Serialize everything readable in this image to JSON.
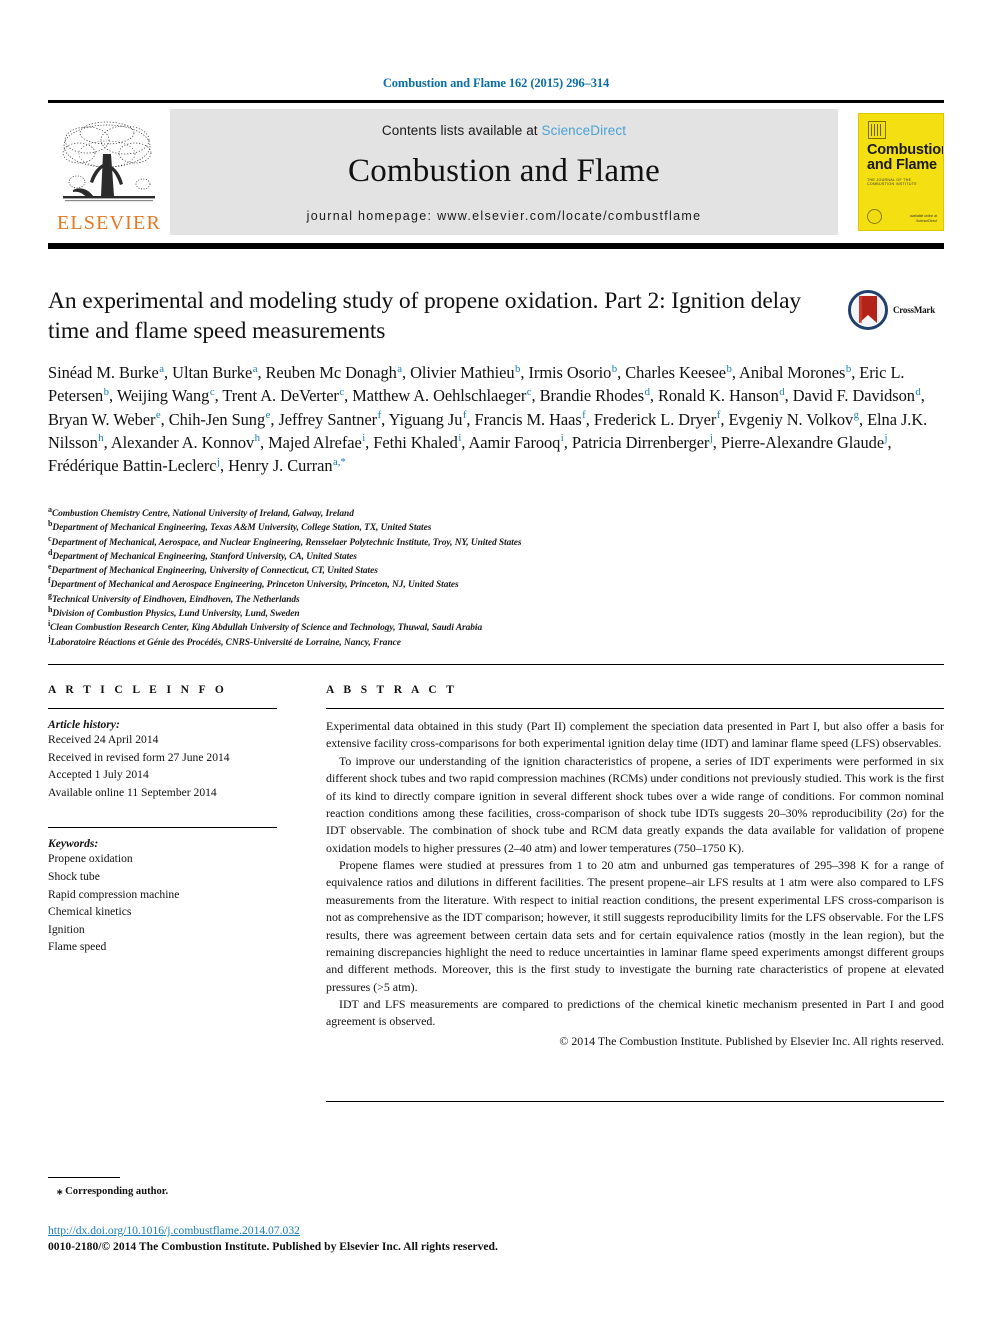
{
  "running_head": "Combustion and Flame 162 (2015) 296–314",
  "masthead": {
    "publisher_logo_label": "ELSEVIER",
    "contents_prefix": "Contents lists available at ",
    "contents_link": "ScienceDirect",
    "journal_name": "Combustion and Flame",
    "homepage": "journal homepage: www.elsevier.com/locate/combustflame",
    "cover": {
      "title_line1": "Combustion",
      "title_line2": "and Flame",
      "subtitle": "THE JOURNAL OF THE COMBUSTION INSTITUTE",
      "footline1": "available online at",
      "footline2": "ScienceDirect"
    }
  },
  "article": {
    "title": "An experimental and modeling study of propene oxidation. Part 2: Ignition delay time and flame speed measurements",
    "crossmark_label": "CrossMark"
  },
  "authors": [
    {
      "name": "Sinéad M. Burke",
      "sup": "a",
      "sep": ", "
    },
    {
      "name": "Ultan Burke",
      "sup": "a",
      "sep": ", "
    },
    {
      "name": "Reuben Mc Donagh",
      "sup": "a",
      "sep": ", "
    },
    {
      "name": "Olivier Mathieu",
      "sup": "b",
      "sep": ", "
    },
    {
      "name": "Irmis Osorio",
      "sup": "b",
      "sep": ", "
    },
    {
      "name": "Charles Keesee",
      "sup": "b",
      "sep": ", "
    },
    {
      "name": "Anibal Morones",
      "sup": "b",
      "sep": ", "
    },
    {
      "name": "Eric L. Petersen",
      "sup": "b",
      "sep": ", "
    },
    {
      "name": "Weijing Wang",
      "sup": "c",
      "sep": ", "
    },
    {
      "name": "Trent A. DeVerter",
      "sup": "c",
      "sep": ", "
    },
    {
      "name": "Matthew A. Oehlschlaeger",
      "sup": "c",
      "sep": ", "
    },
    {
      "name": "Brandie Rhodes",
      "sup": "d",
      "sep": ", "
    },
    {
      "name": "Ronald K. Hanson",
      "sup": "d",
      "sep": ", "
    },
    {
      "name": "David F. Davidson",
      "sup": "d",
      "sep": ", "
    },
    {
      "name": "Bryan W. Weber",
      "sup": "e",
      "sep": ", "
    },
    {
      "name": "Chih-Jen Sung",
      "sup": "e",
      "sep": ", "
    },
    {
      "name": "Jeffrey Santner",
      "sup": "f",
      "sep": ", "
    },
    {
      "name": "Yiguang Ju",
      "sup": "f",
      "sep": ", "
    },
    {
      "name": "Francis M. Haas",
      "sup": "f",
      "sep": ", "
    },
    {
      "name": "Frederick L. Dryer",
      "sup": "f",
      "sep": ", "
    },
    {
      "name": "Evgeniy N. Volkov",
      "sup": "g",
      "sep": ", "
    },
    {
      "name": "Elna J.K. Nilsson",
      "sup": "h",
      "sep": ", "
    },
    {
      "name": "Alexander A. Konnov",
      "sup": "h",
      "sep": ", "
    },
    {
      "name": "Majed Alrefae",
      "sup": "i",
      "sep": ", "
    },
    {
      "name": "Fethi Khaled",
      "sup": "i",
      "sep": ", "
    },
    {
      "name": "Aamir Farooq",
      "sup": "i",
      "sep": ", "
    },
    {
      "name": "Patricia Dirrenberger",
      "sup": "j",
      "sep": ", "
    },
    {
      "name": "Pierre-Alexandre Glaude",
      "sup": "j",
      "sep": ", "
    },
    {
      "name": "Frédérique Battin-Leclerc",
      "sup": "j",
      "sep": ", "
    },
    {
      "name": "Henry J. Curran",
      "sup": "a,*",
      "sep": ""
    }
  ],
  "affiliations": [
    {
      "key": "a",
      "text": "Combustion Chemistry Centre, National University of Ireland, Galway, Ireland"
    },
    {
      "key": "b",
      "text": "Department of Mechanical Engineering, Texas A&M University, College Station, TX, United States"
    },
    {
      "key": "c",
      "text": "Department of Mechanical, Aerospace, and Nuclear Engineering, Rensselaer Polytechnic Institute, Troy, NY, United States"
    },
    {
      "key": "d",
      "text": "Department of Mechanical Engineering, Stanford University, CA, United States"
    },
    {
      "key": "e",
      "text": "Department of Mechanical Engineering, University of Connecticut, CT, United States"
    },
    {
      "key": "f",
      "text": "Department of Mechanical and Aerospace Engineering, Princeton University, Princeton, NJ, United States"
    },
    {
      "key": "g",
      "text": "Technical University of Eindhoven, Eindhoven, The Netherlands"
    },
    {
      "key": "h",
      "text": "Division of Combustion Physics, Lund University, Lund, Sweden"
    },
    {
      "key": "i",
      "text": "Clean Combustion Research Center, King Abdullah University of Science and Technology, Thuwal, Saudi Arabia"
    },
    {
      "key": "j",
      "text": "Laboratoire Réactions et Génie des Procédés, CNRS-Université de Lorraine, Nancy, France"
    }
  ],
  "article_info": {
    "heading": "A R T I C L E   I N F O",
    "history_label": "Article history:",
    "history": [
      "Received 24 April 2014",
      "Received in revised form 27 June 2014",
      "Accepted 1 July 2014",
      "Available online 11 September 2014"
    ],
    "keywords_label": "Keywords:",
    "keywords": [
      "Propene oxidation",
      "Shock tube",
      "Rapid compression machine",
      "Chemical kinetics",
      "Ignition",
      "Flame speed"
    ]
  },
  "abstract": {
    "heading": "A B S T R A C T",
    "paragraphs": [
      "Experimental data obtained in this study (Part II) complement the speciation data presented in Part I, but also offer a basis for extensive facility cross-comparisons for both experimental ignition delay time (IDT) and laminar flame speed (LFS) observables.",
      "To improve our understanding of the ignition characteristics of propene, a series of IDT experiments were performed in six different shock tubes and two rapid compression machines (RCMs) under conditions not previously studied. This work is the first of its kind to directly compare ignition in several different shock tubes over a wide range of conditions. For common nominal reaction conditions among these facilities, cross-comparison of shock tube IDTs suggests 20–30% reproducibility (2σ) for the IDT observable. The combination of shock tube and RCM data greatly expands the data available for validation of propene oxidation models to higher pressures (2–40 atm) and lower temperatures (750–1750 K).",
      "Propene flames were studied at pressures from 1 to 20 atm and unburned gas temperatures of 295–398 K for a range of equivalence ratios and dilutions in different facilities. The present propene–air LFS results at 1 atm were also compared to LFS measurements from the literature. With respect to initial reaction conditions, the present experimental LFS cross-comparison is not as comprehensive as the IDT comparison; however, it still suggests reproducibility limits for the LFS observable. For the LFS results, there was agreement between certain data sets and for certain equivalence ratios (mostly in the lean region), but the remaining discrepancies highlight the need to reduce uncertainties in laminar flame speed experiments amongst different groups and different methods. Moreover, this is the first study to investigate the burning rate characteristics of propene at elevated pressures (>5 atm).",
      "IDT and LFS measurements are compared to predictions of the chemical kinetic mechanism presented in Part I and good agreement is observed."
    ],
    "copyright": "© 2014 The Combustion Institute. Published by Elsevier Inc. All rights reserved."
  },
  "footer": {
    "corresponding_author": "Corresponding author.",
    "doi": "http://dx.doi.org/10.1016/j.combustflame.2014.07.032",
    "issn_line": "0010-2180/© 2014 The Combustion Institute. Published by Elsevier Inc. All rights reserved."
  },
  "colors": {
    "header_blue": "#0b6ea8",
    "link_blue": "#1a7fb5",
    "sciencedirect_blue": "#4ba3d3",
    "elsevier_orange": "#e87722",
    "cover_yellow": "#f4e012",
    "band_grey": "#e3e3e3"
  }
}
